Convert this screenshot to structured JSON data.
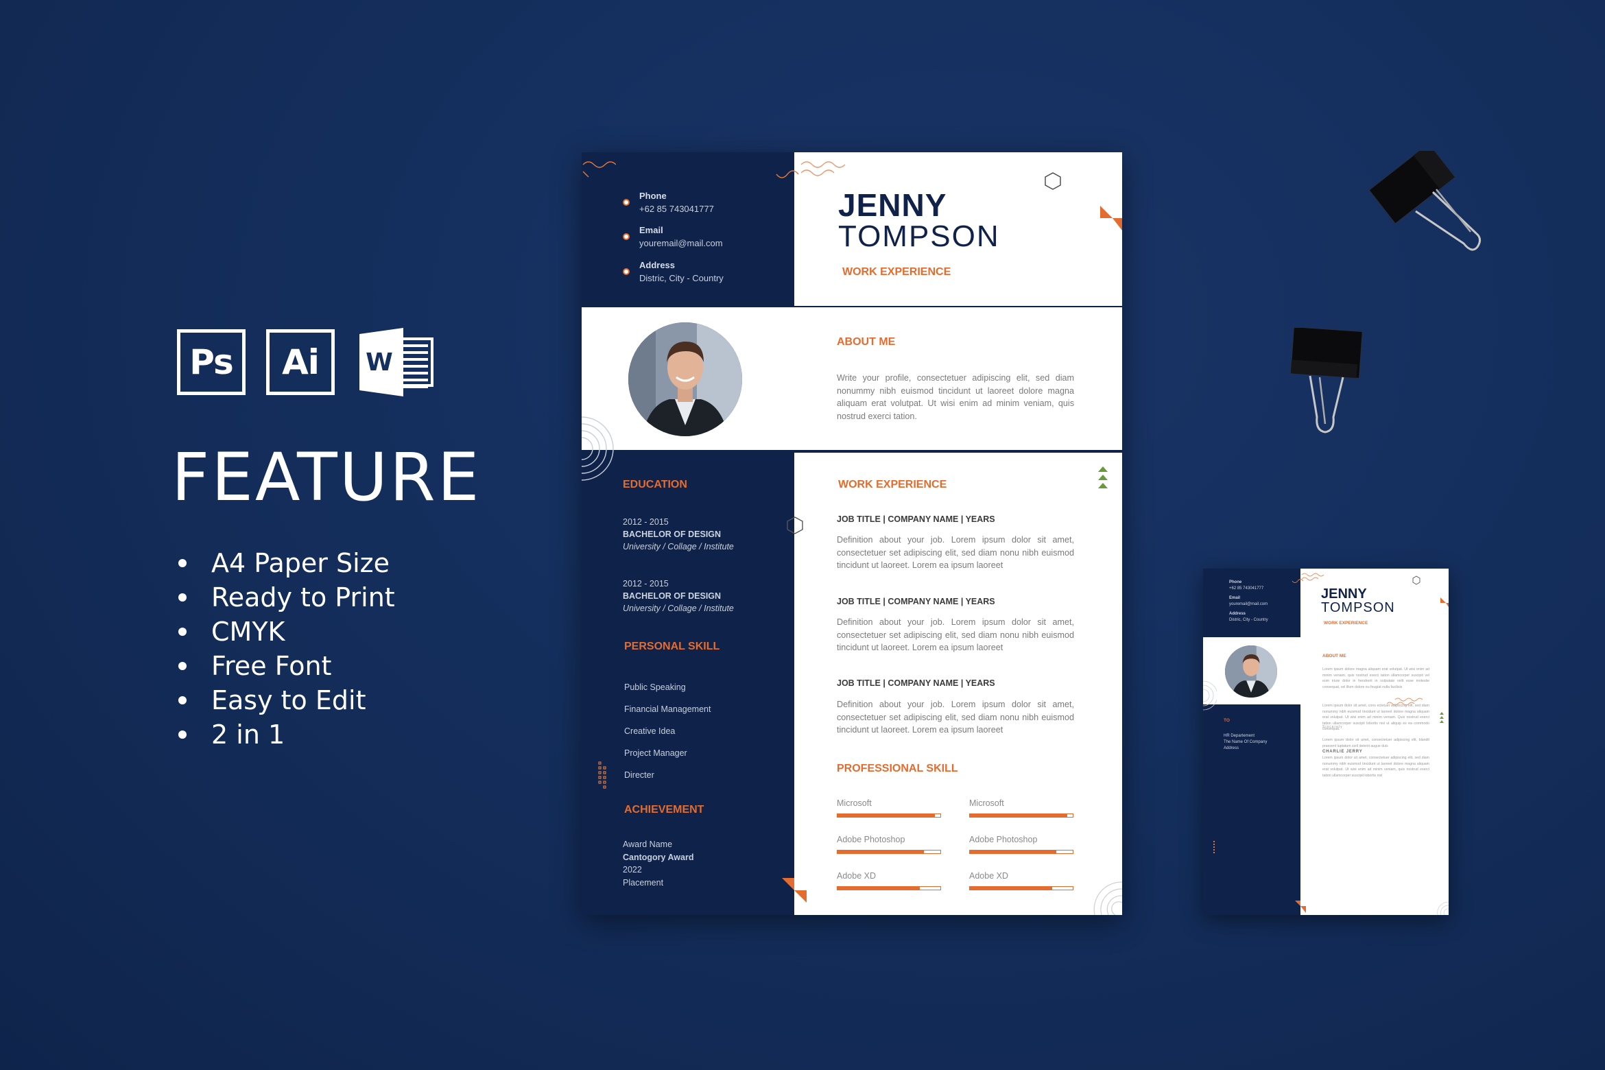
{
  "features": {
    "app_icons": [
      {
        "name": "photoshop-icon",
        "label": "Ps"
      },
      {
        "name": "illustrator-icon",
        "label": "Ai"
      },
      {
        "name": "word-icon",
        "label": "W"
      }
    ],
    "title": "FEATURE",
    "items": [
      "A4 Paper Size",
      "Ready to Print",
      "CMYK",
      "Free Font",
      "Easy to Edit",
      "2 in 1"
    ]
  },
  "colors": {
    "background": "#15305f",
    "navy": "#0f2249",
    "accent_orange": "#e46c2e",
    "accent_green": "#6a9a3a"
  },
  "resume": {
    "contact": [
      {
        "label": "Phone",
        "value": "+62 85 743041777"
      },
      {
        "label": "Email",
        "value": "youremail@mail.com"
      },
      {
        "label": "Address",
        "value": "Distric, City - Country"
      }
    ],
    "first_name": "JENNY",
    "last_name": "TOMPSON",
    "subtitle": "WORK EXPERIENCE",
    "about": {
      "title": "ABOUT ME",
      "text": "Write your profile, consectetuer adipiscing elit, sed diam nonummy nibh euismod tincidunt ut laoreet dolore magna aliquam erat volutpat. Ut wisi enim ad minim veniam, quis nostrud exerci tation."
    },
    "education": {
      "title": "EDUCATION",
      "items": [
        {
          "years": "2012 - 2015",
          "degree": "BACHELOR OF DESIGN",
          "institution": "University / Collage / Institute"
        },
        {
          "years": "2012 - 2015",
          "degree": "BACHELOR OF DESIGN",
          "institution": "University / Collage / Institute"
        }
      ]
    },
    "personal_skill": {
      "title": "PERSONAL SKILL",
      "items": [
        "Public Speaking",
        "Financial Management",
        "Creative Idea",
        "Project Manager",
        "Directer"
      ]
    },
    "achievement": {
      "title": "ACHIEVEMENT",
      "award_name": "Award Name",
      "category": "Cantogory Award",
      "year": "2022",
      "placement": "Placement"
    },
    "work_experience": {
      "title": "WORK EXPERIENCE",
      "jobs": [
        {
          "heading": "JOB TITLE | COMPANY NAME | YEARS",
          "text": "Definition about your job. Lorem ipsum dolor sit amet, consectetuer set adipiscing elit, sed diam nonu nibh euismod tincidunt ut laoreet. Lorem ea ipsum laoreet"
        },
        {
          "heading": "JOB TITLE | COMPANY NAME | YEARS",
          "text": "Definition about your job. Lorem ipsum dolor sit amet, consectetuer set adipiscing elit, sed diam nonu nibh euismod tincidunt ut laoreet. Lorem ea ipsum laoreet"
        },
        {
          "heading": "JOB TITLE | COMPANY NAME | YEARS",
          "text": "Definition about your job. Lorem ipsum dolor sit amet, consectetuer set adipiscing elit, sed diam nonu nibh euismod tincidunt ut laoreet. Lorem ea ipsum laoreet"
        }
      ]
    },
    "professional_skill": {
      "title": "PROFESSIONAL SKILL",
      "columns": [
        [
          {
            "name": "Microsoft",
            "level": 0.95
          },
          {
            "name": "Adobe Photoshop",
            "level": 0.84
          },
          {
            "name": "Adobe XD",
            "level": 0.8
          }
        ],
        [
          {
            "name": "Microsoft",
            "level": 0.95
          },
          {
            "name": "Adobe Photoshop",
            "level": 0.84
          },
          {
            "name": "Adobe XD",
            "level": 0.8
          }
        ]
      ]
    }
  },
  "cover_letter": {
    "contact": [
      {
        "label": "Phone",
        "value": "+62 85 743041777"
      },
      {
        "label": "Email",
        "value": "youremail@mail.com"
      },
      {
        "label": "Address",
        "value": "Distric, City - Country"
      }
    ],
    "first_name": "JENNY",
    "last_name": "TOMPSON",
    "subtitle": "WORK EXPERIENCE",
    "about_title": "ABOUT ME",
    "paragraphs": [
      "Lorem ipsum dolore magna aliquam erat volutpat. Ut wisi enim ad minim veniam, quis nostrud exerci tation ullamcorper suscipit vel eum iriure dolor in hendrerit in vulputate velit esse molestie consequat, vel illum dolore eu feugiat nulla facilisis",
      "Lorem ipsum dolor sit amet, cons ectetuer adipiscing elit, sed diam nonummy nibh euismod tincidunt ut laoreet dolore magna aliquam erat volutpat. Ut wisi enim ad minim veniam. Quis nostrud exerci tation ullamcorper suscipit lobortis nisl ut aliquip ex ea commodo consequat.",
      "Lorem ipsum dolor sit amet, consectetuer adipiscing elit, blandit praesent luptatum zzril delenit augue duis",
      "Lorem ipsum dolor sit amet, consectetuer adipiscing elit, sed diam nonummy nibh euismod tincidunt ut laoreet dolore magna aliquam erat volutpat. Ut wisi enim ad minim veniam, quis nostrud exerci tation ullamcorper suscipit lobortis nisl"
    ],
    "to": {
      "title": "TO",
      "lines": [
        "HR Departement",
        "The Name Of Company",
        "Address"
      ]
    },
    "closing": "Sincerely",
    "signature": "CHARLIE JERRY"
  }
}
